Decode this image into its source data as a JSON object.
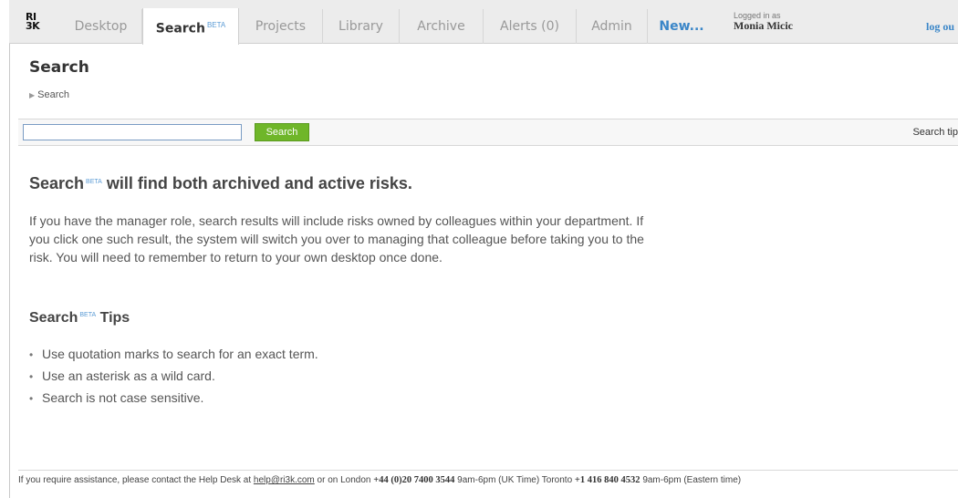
{
  "nav": {
    "logo_top": "RI",
    "logo_bottom": "3K",
    "tabs": [
      {
        "label": "Desktop"
      },
      {
        "label": "Search",
        "badge": "BETA"
      },
      {
        "label": "Projects"
      },
      {
        "label": "Library"
      },
      {
        "label": "Archive"
      },
      {
        "label": "Alerts (0)"
      },
      {
        "label": "Admin"
      },
      {
        "label": "New..."
      }
    ],
    "logged_in_label": "Logged in as",
    "user_name": "Monia Micic",
    "logout": "log ou"
  },
  "header": {
    "title": "Search",
    "breadcrumb": "Search"
  },
  "searchbar": {
    "value": "",
    "button": "Search",
    "tips_link": "Search tip"
  },
  "content": {
    "heading_pre": "Search",
    "heading_badge": "BETA",
    "heading_post": "will find both archived and active risks.",
    "paragraph": "If you have the manager role, search results will include risks owned by colleagues within your department. If you click one such result, the system will switch you over to managing that colleague before taking you to the risk. You will need to remember to return to your own desktop once done.",
    "tips_pre": "Search",
    "tips_badge": "BETA",
    "tips_post": "Tips",
    "tips": [
      "Use quotation marks to search for an exact term.",
      "Use an asterisk as a wild card.",
      "Search is not case sensitive."
    ]
  },
  "footer": {
    "part1": "If you require assistance, please contact the Help Desk at",
    "email": "help@ri3k.com",
    "part2": "or on London",
    "london_phone": "+44 (0)20 7400 3544",
    "london_hours": "9am-6pm (UK Time) Toronto",
    "toronto_phone": "+1 416 840 4532",
    "toronto_hours": "9am-6pm (Eastern time)"
  },
  "colors": {
    "accent": "#3a86c8",
    "search_button": "#6fb629"
  }
}
